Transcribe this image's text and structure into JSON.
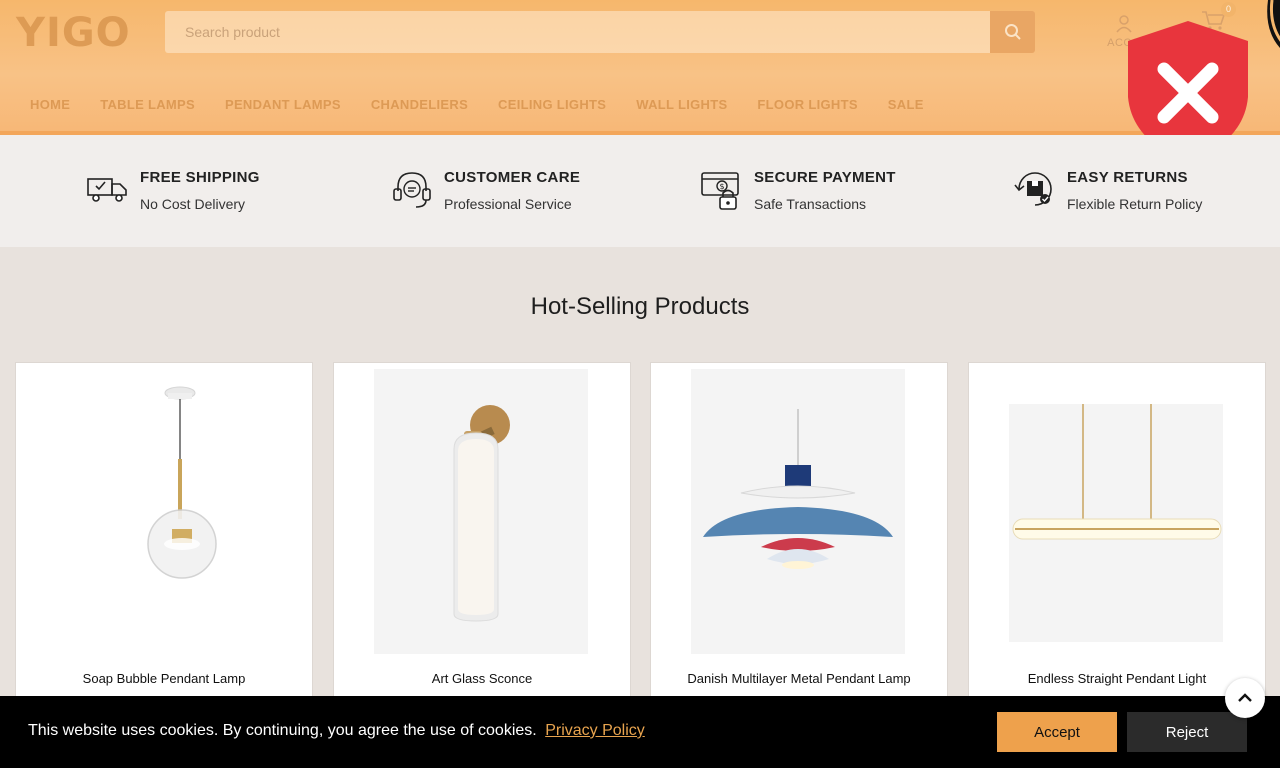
{
  "header": {
    "logo": "YIGO",
    "search_placeholder": "Search product",
    "account_label": "ACCO",
    "cart_count": "0"
  },
  "nav": [
    "HOME",
    "TABLE LAMPS",
    "PENDANT LAMPS",
    "CHANDELIERS",
    "CEILING LIGHTS",
    "WALL LIGHTS",
    "FLOOR LIGHTS",
    "SALE"
  ],
  "features": [
    {
      "icon": "truck-icon",
      "title": "FREE SHIPPING",
      "sub": "No Cost Delivery"
    },
    {
      "icon": "headset-icon",
      "title": "CUSTOMER CARE",
      "sub": "Professional Service"
    },
    {
      "icon": "secure-payment-icon",
      "title": "SECURE PAYMENT",
      "sub": "Safe Transactions"
    },
    {
      "icon": "return-box-icon",
      "title": "EASY RETURNS",
      "sub": "Flexible Return Policy"
    }
  ],
  "section_title": "Hot-Selling Products",
  "products": [
    {
      "name": "Soap Bubble Pendant Lamp"
    },
    {
      "name": "Art Glass Sconce"
    },
    {
      "name": "Danish Multilayer Metal Pendant Lamp"
    },
    {
      "name": "Endless Straight Pendant Light"
    }
  ],
  "cookie": {
    "message": "This website uses cookies. By continuing, you agree the use of cookies.",
    "link": "Privacy Policy",
    "accept": "Accept",
    "reject": "Reject"
  },
  "colors": {
    "accent": "#eea14c",
    "header": "#f7b776",
    "shield": "#e8353d"
  }
}
